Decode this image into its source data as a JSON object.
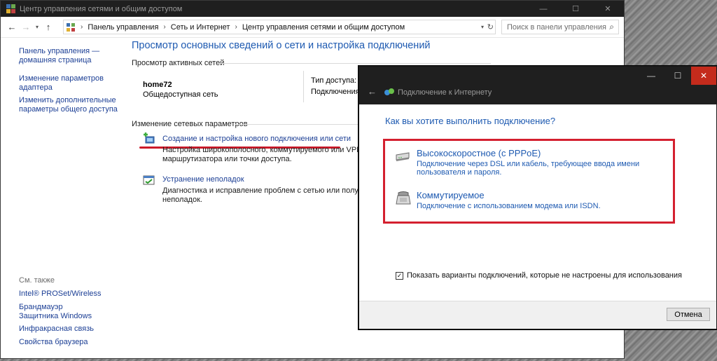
{
  "main_window": {
    "title": "Центр управления сетями и общим доступом",
    "controls": {
      "minimize": "—",
      "maximize": "☐",
      "close": "✕"
    }
  },
  "address_bar": {
    "crumbs": [
      "Панель управления",
      "Сеть и Интернет",
      "Центр управления сетями и общим доступом"
    ],
    "search_placeholder": "Поиск в панели управления"
  },
  "left_pane": {
    "links": [
      "Панель управления — домашняя страница",
      "Изменение параметров адаптера",
      "Изменить дополнительные параметры общего доступа"
    ],
    "see_also_heading": "См. также",
    "see_also": [
      "Intel® PROSet/Wireless",
      "Брандмауэр Защитника Windows",
      "Инфракрасная связь",
      "Свойства браузера"
    ]
  },
  "content": {
    "page_title": "Просмотр основных сведений о сети и настройка подключений",
    "active_networks_label": "Просмотр активных сетей",
    "network": {
      "name": "home72",
      "type": "Общедоступная сеть",
      "access_type_label": "Тип доступа:",
      "connections_label": "Подключения:"
    },
    "change_settings_label": "Изменение сетевых параметров",
    "tasks": [
      {
        "link": "Создание и настройка нового подключения или сети",
        "desc_line1": "Настройка широкополосного, коммутируемого или VPN-под",
        "desc_line2": "маршрутизатора или точки доступа."
      },
      {
        "link": "Устранение неполадок",
        "desc_line1": "Диагностика и исправление проблем с сетью или получение",
        "desc_line2": "неполадок."
      }
    ]
  },
  "dialog": {
    "title": "Подключение к Интернету",
    "question": "Как вы хотите выполнить подключение?",
    "options": [
      {
        "title": "Высокоскоростное (с PPPoE)",
        "desc": "Подключение через DSL или кабель, требующее ввода имени пользователя и пароля."
      },
      {
        "title": "Коммутируемое",
        "desc": "Подключение с использованием модема или ISDN."
      }
    ],
    "checkbox_label": "Показать варианты подключений, которые не настроены для использования",
    "checkbox_checked": true,
    "cancel_label": "Отмена",
    "controls": {
      "minimize": "—",
      "maximize": "☐",
      "close": "✕"
    }
  },
  "colors": {
    "link_blue": "#1e5ab1",
    "titlebar": "#1f1f1f",
    "highlight_red": "#d4202f",
    "close_red": "#c42b1c"
  }
}
